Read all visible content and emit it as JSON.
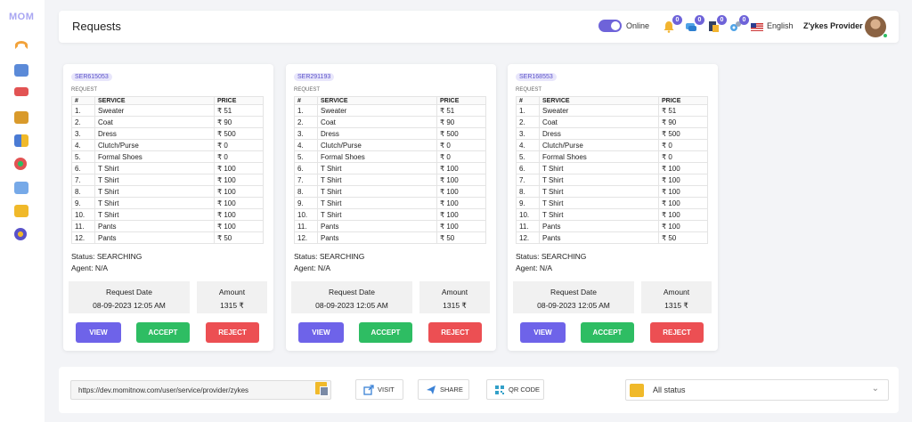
{
  "app": {
    "logo": "MOM"
  },
  "header": {
    "title": "Requests",
    "status_label": "Online",
    "notification_counts": [
      "0",
      "0",
      "0",
      "0"
    ],
    "language": "English",
    "user_name": "Z'ykes Provider"
  },
  "sidebar": {
    "icons": [
      "dashboard-icon",
      "monitor-icon",
      "truck-icon",
      "document-icon",
      "grid-icon",
      "globe-icon",
      "calendar-icon",
      "chat-icon",
      "settings-icon"
    ]
  },
  "labels": {
    "request": "REQUEST",
    "col_num": "#",
    "col_service": "SERVICE",
    "col_price": "PRICE",
    "request_date": "Request Date",
    "amount": "Amount",
    "view": "VIEW",
    "accept": "ACCEPT",
    "reject": "REJECT"
  },
  "cards": [
    {
      "id": "SER615053",
      "status": "Status: SEARCHING",
      "agent": "Agent: N/A",
      "request_date": "08-09-2023 12:05 AM",
      "amount": "1315 ₹",
      "rows": [
        [
          "1.",
          "Sweater",
          "₹ 51"
        ],
        [
          "2.",
          "Coat",
          "₹ 90"
        ],
        [
          "3.",
          "Dress",
          "₹ 500"
        ],
        [
          "4.",
          "Clutch/Purse",
          "₹ 0"
        ],
        [
          "5.",
          "Formal Shoes",
          "₹ 0"
        ],
        [
          "6.",
          "T Shirt",
          "₹ 100"
        ],
        [
          "7.",
          "T Shirt",
          "₹ 100"
        ],
        [
          "8.",
          "T Shirt",
          "₹ 100"
        ],
        [
          "9.",
          "T Shirt",
          "₹ 100"
        ],
        [
          "10.",
          "T Shirt",
          "₹ 100"
        ],
        [
          "11.",
          "Pants",
          "₹ 100"
        ],
        [
          "12.",
          "Pants",
          "₹ 50"
        ]
      ]
    },
    {
      "id": "SER291193",
      "status": "Status: SEARCHING",
      "agent": "Agent: N/A",
      "request_date": "08-09-2023 12:05 AM",
      "amount": "1315 ₹",
      "rows": [
        [
          "1.",
          "Sweater",
          "₹ 51"
        ],
        [
          "2.",
          "Coat",
          "₹ 90"
        ],
        [
          "3.",
          "Dress",
          "₹ 500"
        ],
        [
          "4.",
          "Clutch/Purse",
          "₹ 0"
        ],
        [
          "5.",
          "Formal Shoes",
          "₹ 0"
        ],
        [
          "6.",
          "T Shirt",
          "₹ 100"
        ],
        [
          "7.",
          "T Shirt",
          "₹ 100"
        ],
        [
          "8.",
          "T Shirt",
          "₹ 100"
        ],
        [
          "9.",
          "T Shirt",
          "₹ 100"
        ],
        [
          "10.",
          "T Shirt",
          "₹ 100"
        ],
        [
          "11.",
          "Pants",
          "₹ 100"
        ],
        [
          "12.",
          "Pants",
          "₹ 50"
        ]
      ]
    },
    {
      "id": "SER168553",
      "status": "Status: SEARCHING",
      "agent": "Agent: N/A",
      "request_date": "08-09-2023 12:05 AM",
      "amount": "1315 ₹",
      "rows": [
        [
          "1.",
          "Sweater",
          "₹ 51"
        ],
        [
          "2.",
          "Coat",
          "₹ 90"
        ],
        [
          "3.",
          "Dress",
          "₹ 500"
        ],
        [
          "4.",
          "Clutch/Purse",
          "₹ 0"
        ],
        [
          "5.",
          "Formal Shoes",
          "₹ 0"
        ],
        [
          "6.",
          "T Shirt",
          "₹ 100"
        ],
        [
          "7.",
          "T Shirt",
          "₹ 100"
        ],
        [
          "8.",
          "T Shirt",
          "₹ 100"
        ],
        [
          "9.",
          "T Shirt",
          "₹ 100"
        ],
        [
          "10.",
          "T Shirt",
          "₹ 100"
        ],
        [
          "11.",
          "Pants",
          "₹ 100"
        ],
        [
          "12.",
          "Pants",
          "₹ 50"
        ]
      ]
    }
  ],
  "footer": {
    "url": "https://dev.momitnow.com/user/service/provider/zykes",
    "visit": "VISIT",
    "share": "SHARE",
    "qr": "QR CODE",
    "filter_value": "All status"
  },
  "colors": {
    "accent": "#6e63e9",
    "accept": "#2ebd63",
    "reject": "#ec4f53",
    "badge": "#6e63d9"
  }
}
